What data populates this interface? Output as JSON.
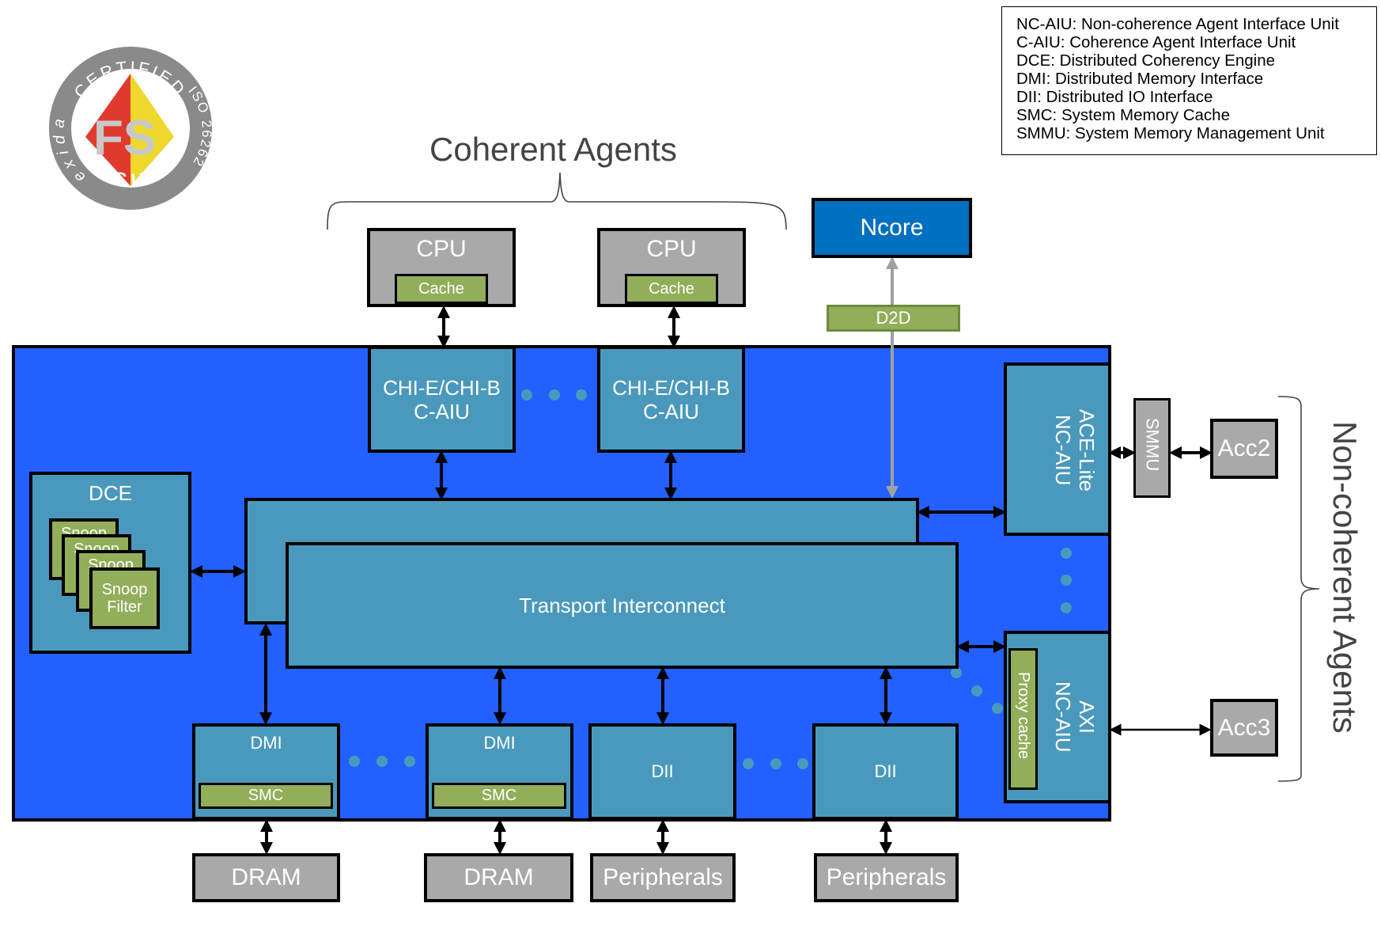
{
  "logo": {
    "ring_top": "CERTIFIED",
    "ring_left": "exida",
    "ring_right": "ISO 26262",
    "ring_bottom": "ASIL D",
    "center": "FS",
    "colors": {
      "ring": "#8a8a8a",
      "red": "#e03a2e",
      "yellow": "#eed82e",
      "letters": "#c8c8c8"
    }
  },
  "legend": [
    "NC-AIU: Non-coherence Agent Interface Unit",
    "C-AIU: Coherence Agent Interface Unit",
    "DCE: Distributed Coherency Engine",
    "DMI: Distributed Memory Interface",
    "DII: Distributed IO Interface",
    "SMC: System Memory Cache",
    "SMMU: System Memory Management Unit"
  ],
  "groups": {
    "coherent": "Coherent Agents",
    "noncoherent": "Non-coherent Agents"
  },
  "cpus": [
    {
      "label": "CPU",
      "cache": "Cache"
    },
    {
      "label": "CPU",
      "cache": "Cache"
    }
  ],
  "caius": [
    {
      "line1": "CHI-E/CHI-B",
      "line2": "C-AIU"
    },
    {
      "line1": "CHI-E/CHI-B",
      "line2": "C-AIU"
    }
  ],
  "ncore": "Ncore",
  "d2d": "D2D",
  "dce": {
    "label": "DCE",
    "snoop_line1": "Snoop",
    "snoop_line2": "Filter"
  },
  "interconnect": "Transport Interconnect",
  "nc_aius": [
    {
      "line1": "ACE-Lite",
      "line2": "NC-AIU"
    },
    {
      "line1": "AXI",
      "line2": "NC-AIU",
      "sub": "Proxy cache"
    }
  ],
  "smmu": "SMMU",
  "accelerators": [
    "Acc2",
    "Acc3"
  ],
  "dmis": [
    {
      "label": "DMI",
      "smc": "SMC"
    },
    {
      "label": "DMI",
      "smc": "SMC"
    }
  ],
  "diis": [
    "DII",
    "DII"
  ],
  "memories": [
    "DRAM",
    "DRAM"
  ],
  "peripherals": [
    "Peripherals",
    "Peripherals"
  ],
  "colors": {
    "fabric": "#2360ff",
    "unit": "#4a99bd",
    "agent": "#a9a9a9",
    "cache": "#92ae5a",
    "ncore": "#0070c0"
  }
}
